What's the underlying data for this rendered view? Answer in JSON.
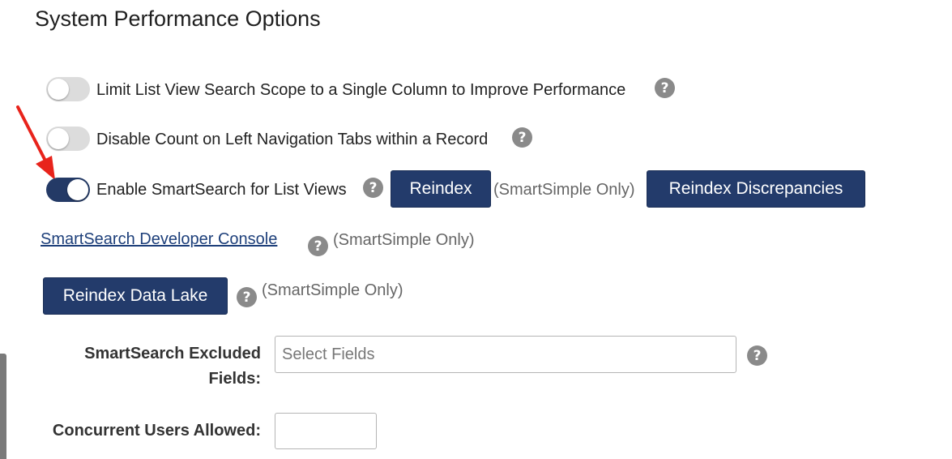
{
  "page": {
    "title": "System Performance Options"
  },
  "options": [
    {
      "label": "Limit List View Search Scope to a Single Column to Improve Performance",
      "enabled": false
    },
    {
      "label": "Disable Count on Left Navigation Tabs within a Record",
      "enabled": false
    },
    {
      "label": "Enable SmartSearch for List Views",
      "enabled": true
    }
  ],
  "smartsearch": {
    "reindex_label": "Reindex",
    "smartsimple_only": "(SmartSimple Only)",
    "reindex_discrepancies_label": "Reindex Discrepancies",
    "developer_console_link": "SmartSearch Developer Console",
    "reindex_data_lake_label": "Reindex Data Lake"
  },
  "fields": {
    "excluded_fields_label": "SmartSearch Excluded Fields:",
    "excluded_fields_placeholder": "Select Fields",
    "concurrent_users_label": "Concurrent Users Allowed:",
    "concurrent_users_value": ""
  },
  "icons": {
    "help": "?"
  },
  "colors": {
    "accent": "#233b6b",
    "toggle_off": "#dcdcdc",
    "annotation_arrow": "#e8231b"
  }
}
